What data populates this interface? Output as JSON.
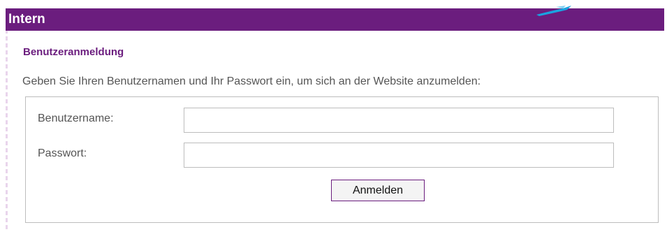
{
  "header": {
    "title": "Intern"
  },
  "login": {
    "section_title": "Benutzeranmeldung",
    "intro": "Geben Sie Ihren Benutzernamen und Ihr Passwort ein, um sich an der Website anzumelden:",
    "username_label": "Benutzername:",
    "username_value": "",
    "password_label": "Passwort:",
    "password_value": "",
    "submit_label": "Anmelden"
  },
  "colors": {
    "brand_purple": "#6b1d7e",
    "accent_blue": "#1aa3e0"
  }
}
